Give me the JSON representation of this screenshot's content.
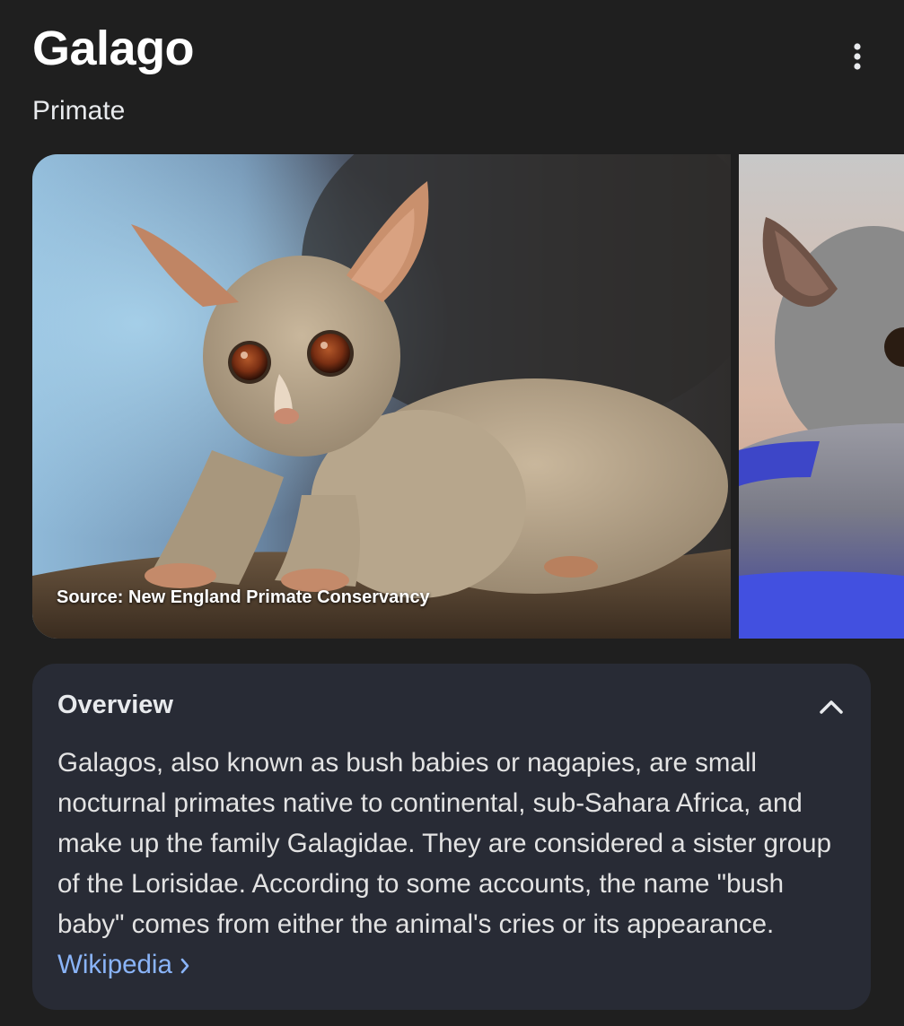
{
  "entity": {
    "title": "Galago",
    "subtitle": "Primate"
  },
  "menu": {
    "icon": "more-vert-icon"
  },
  "images": {
    "main_caption": "Source: New England Primate Conservancy"
  },
  "overview": {
    "heading": "Overview",
    "collapse_icon": "chevron-up-icon",
    "text": "Galagos, also known as bush babies or nagapies, are small nocturnal primates native to continental, sub-Sahara Africa, and make up the family Galagidae. They are considered a sister group of the Lorisidae. According to some accounts, the name \"bush baby\" comes from either the animal's cries or its appearance. ",
    "source_link": "Wikipedia",
    "source_link_icon": "chevron-right-icon"
  },
  "colors": {
    "background": "#1f1f1f",
    "card": "#282b35",
    "link": "#8ab4f8"
  }
}
